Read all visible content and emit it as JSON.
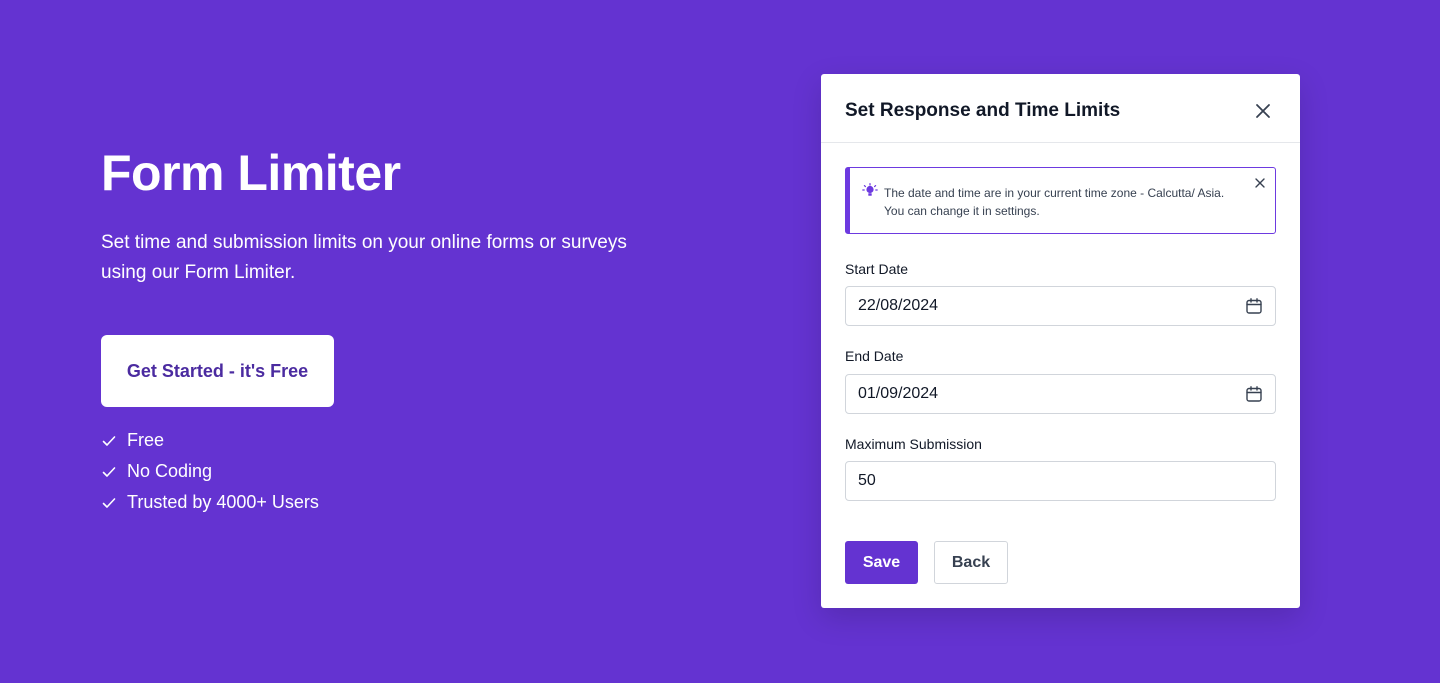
{
  "hero": {
    "title": "Form Limiter",
    "subtitle": "Set time and submission limits on your online forms or surveys using our Form Limiter.",
    "cta_label": "Get Started - it's Free",
    "features": [
      "Free",
      "No Coding",
      "Trusted by 4000+  Users"
    ]
  },
  "modal": {
    "title": "Set Response and Time Limits",
    "notice": "The date and time are in your current time zone - Calcutta/ Asia. You can change it in settings.",
    "start_date_label": "Start Date",
    "start_date_value": "22/08/2024",
    "end_date_label": "End Date",
    "end_date_value": "01/09/2024",
    "max_submission_label": "Maximum Submission",
    "max_submission_value": "50",
    "save_label": "Save",
    "back_label": "Back"
  },
  "colors": {
    "background": "#6433d1",
    "accent": "#6433d1",
    "cta_text": "#4b2ba0",
    "notice_border": "#6d3ae0"
  },
  "icons": {
    "close": "close-icon",
    "bulb": "lightbulb-icon",
    "calendar": "calendar-icon",
    "check": "check-icon"
  }
}
